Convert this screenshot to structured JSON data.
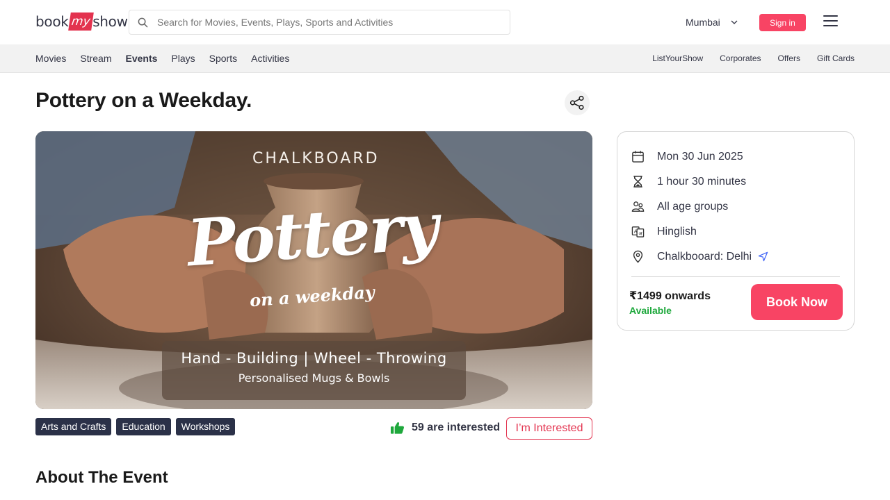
{
  "header": {
    "logo": {
      "part1": "book",
      "part2": "my",
      "part3": "show"
    },
    "search_placeholder": "Search for Movies, Events, Plays, Sports and Activities",
    "city": "Mumbai",
    "signin_label": "Sign in"
  },
  "nav": {
    "left": [
      "Movies",
      "Stream",
      "Events",
      "Plays",
      "Sports",
      "Activities"
    ],
    "active": "Events",
    "right": [
      "ListYourShow",
      "Corporates",
      "Offers",
      "Gift Cards"
    ]
  },
  "event": {
    "title": "Pottery on a Weekday.",
    "banner": {
      "brand": "CHALKBOARD",
      "headline": "Pottery",
      "subheadline": "on a weekday",
      "line1": "Hand - Building | Wheel - Throwing",
      "line2": "Personalised Mugs & Bowls"
    },
    "details": {
      "date": "Mon 30 Jun 2025",
      "duration": "1 hour 30 minutes",
      "age": "All age groups",
      "language": "Hinglish",
      "venue": "Chalkbooard: Delhi"
    },
    "price": "₹1499 onwards",
    "availability": "Available",
    "book_label": "Book Now",
    "tags": [
      "Arts and Crafts",
      "Education",
      "Workshops"
    ],
    "interested_text": "59 are interested",
    "interested_button": "I’m Interested"
  },
  "about_heading": "About The Event",
  "colors": {
    "brand_red": "#f84464",
    "tag_bg": "#2b3148",
    "available_green": "#1ea83c"
  }
}
